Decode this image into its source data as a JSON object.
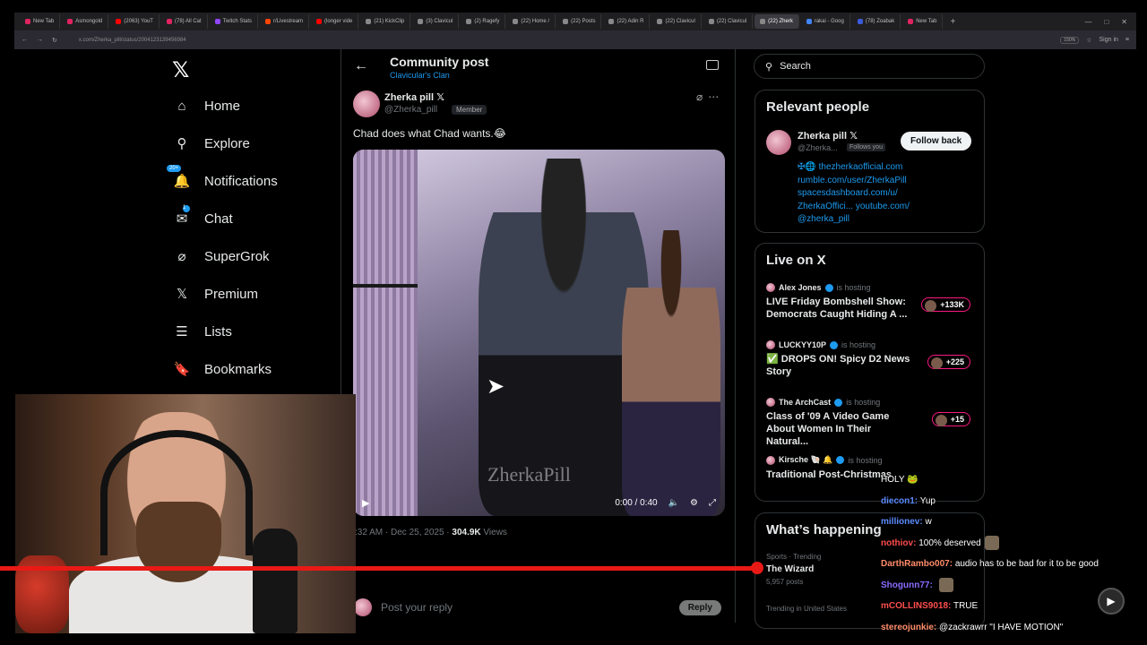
{
  "browser": {
    "tabs": [
      {
        "label": "New Tab",
        "color": "#e0245e"
      },
      {
        "label": "Asmongold",
        "color": "#e0245e"
      },
      {
        "label": "(2063) YouT",
        "color": "#ff0000"
      },
      {
        "label": "(78) All Cat",
        "color": "#e0245e"
      },
      {
        "label": "Twitch Stats",
        "color": "#9146ff"
      },
      {
        "label": "r/Livestream",
        "color": "#ff4500"
      },
      {
        "label": "(longer vide",
        "color": "#ff0000"
      },
      {
        "label": "(21) KickClip",
        "color": "#888888"
      },
      {
        "label": "(3) Clavicul",
        "color": "#888888"
      },
      {
        "label": "(2) Ragefy",
        "color": "#888888"
      },
      {
        "label": "(22) Home /",
        "color": "#888888"
      },
      {
        "label": "(22) Posts",
        "color": "#888888"
      },
      {
        "label": "(22) Adin R",
        "color": "#888888"
      },
      {
        "label": "(22) Clavicul",
        "color": "#888888"
      },
      {
        "label": "(22) Clavicul",
        "color": "#888888"
      },
      {
        "label": "(22) Zherk",
        "color": "#888888"
      },
      {
        "label": "rakai - Goog",
        "color": "#4285f4"
      },
      {
        "label": "(78) Zoabak",
        "color": "#3b5bdb"
      },
      {
        "label": "New Tab",
        "color": "#e0245e"
      }
    ],
    "active_tab_index": 15,
    "url": "x.com/Zherka_pill/status/2004123139456984",
    "zoom": "150%",
    "sign_in": "Sign in",
    "window_controls": [
      "—",
      "□",
      "✕"
    ]
  },
  "nav": {
    "logo": "𝕏",
    "items": [
      {
        "label": "Home",
        "icon": "home-icon",
        "glyph": "⌂"
      },
      {
        "label": "Explore",
        "icon": "search-icon",
        "glyph": "⚲"
      },
      {
        "label": "Notifications",
        "icon": "bell-icon",
        "glyph": "🔔",
        "badge": "20+"
      },
      {
        "label": "Chat",
        "icon": "mail-icon",
        "glyph": "✉",
        "badge": "1"
      },
      {
        "label": "SuperGrok",
        "icon": "grok-icon",
        "glyph": "⌀"
      },
      {
        "label": "Premium",
        "icon": "x-premium-icon",
        "glyph": "𝕏"
      },
      {
        "label": "Lists",
        "icon": "list-icon",
        "glyph": "☰"
      },
      {
        "label": "Bookmarks",
        "icon": "bookmark-icon",
        "glyph": "🔖"
      }
    ]
  },
  "post": {
    "header_title": "Community post",
    "header_sub": "Clavicular's Clan",
    "author_name": "Zherka pill 𝕏",
    "author_handle": "@Zherka_pill",
    "member_label": "Member",
    "text": "Chad does what Chad wants.😂",
    "video_watermark": "ZherkaPill",
    "video_time": "0:00 / 0:40",
    "timestamp": ":32 AM · Dec 25, 2025 · ",
    "views_count": "304.9K",
    "views_label": " Views",
    "reply_placeholder": "Post your reply",
    "reply_button": "Reply"
  },
  "right": {
    "search_placeholder": "Search",
    "relevant_title": "Relevant people",
    "relevant": {
      "name": "Zherka pill 𝕏",
      "handle": "@Zherka...",
      "follows_you": "Follows you",
      "follow_button": "Follow back",
      "bio_lines": [
        "✠🌐 thezherkaofficial.com",
        "rumble.com/user/ZherkaPill",
        "spacesdashboard.com/u/",
        "ZherkaOffici... youtube.com/",
        "@zherka_pill"
      ]
    },
    "live_title": "Live on X",
    "live": [
      {
        "host": "Alex Jones",
        "hosting": "is hosting",
        "title": "LIVE Friday Bombshell Show: Democrats Caught Hiding A ...",
        "count": "+133K"
      },
      {
        "host": "LUCKYY10P",
        "hosting": "is hosting",
        "title": "✅ DROPS ON! Spicy D2 News Story",
        "count": "+225"
      },
      {
        "host": "The ArchCast",
        "hosting": "is hosting",
        "title": "Class of '09 A Video Game About Women In Their Natural...",
        "count": "+15"
      },
      {
        "host": "Kirsche 🐚 🔔",
        "hosting": "is hosting",
        "title": "Traditional Post-Christmas",
        "count": ""
      }
    ],
    "happening_title": "What’s happening",
    "trend_category": "Sports · Trending",
    "trend_name": "The Wizard",
    "trend_posts": "5,957 posts",
    "trend_category2": "Trending in United States"
  },
  "chat": [
    {
      "user": "",
      "user_color": "#ff4d4d",
      "text": "HOLY 🐸"
    },
    {
      "user": "diecon1:",
      "user_color": "#5b8cff",
      "text": "Yup"
    },
    {
      "user": "millionev:",
      "user_color": "#5b8cff",
      "text": "w"
    },
    {
      "user": "nothiov:",
      "user_color": "#ff4d4d",
      "text": "100% deserved"
    },
    {
      "user": "DarthRambo007:",
      "user_color": "#ff8c69",
      "text": "audio has to be bad for it to be good"
    },
    {
      "user": "Shogunn77:",
      "user_color": "#8a6cff",
      "text": ""
    },
    {
      "user": "mCOLLINS9018:",
      "user_color": "#ff4d4d",
      "text": "TRUE"
    },
    {
      "user": "stereojunkie:",
      "user_color": "#ff8c69",
      "text": "@zackrawrr \"I HAVE MOTION\""
    }
  ],
  "stream": {
    "progress": 0.66
  }
}
